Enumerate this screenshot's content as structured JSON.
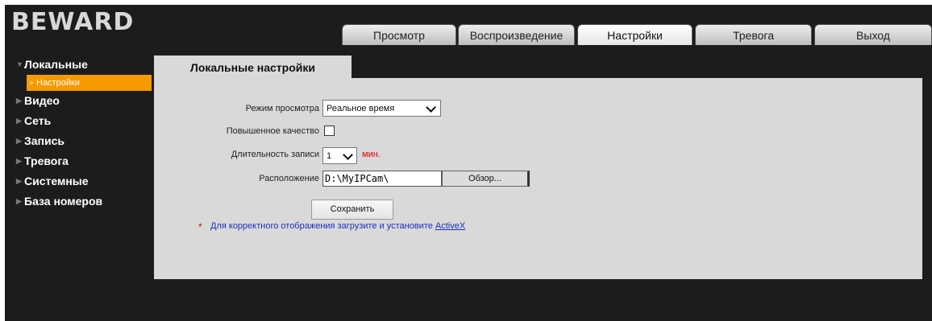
{
  "app": {
    "logo": "BEWARD"
  },
  "tabs": [
    {
      "label": "Просмотр",
      "active": false
    },
    {
      "label": "Воспроизведение",
      "active": false
    },
    {
      "label": "Настройки",
      "active": true
    },
    {
      "label": "Тревога",
      "active": false
    },
    {
      "label": "Выход",
      "active": false
    }
  ],
  "sidebar": {
    "items": [
      {
        "label": "Локальные",
        "expanded": true
      },
      {
        "label": "Видео"
      },
      {
        "label": "Сеть"
      },
      {
        "label": "Запись"
      },
      {
        "label": "Тревога"
      },
      {
        "label": "Системные"
      },
      {
        "label": "База номеров"
      }
    ],
    "sub_item": {
      "label": "Настройки"
    }
  },
  "content": {
    "tab_title": "Локальные настройки",
    "view_mode": {
      "label": "Режим просмотра",
      "value": "Реальное время"
    },
    "quality": {
      "label": "Повышенное качество",
      "checked": false
    },
    "duration": {
      "label": "Длительность записи",
      "value": "1",
      "unit": "мин."
    },
    "location": {
      "label": "Расположение",
      "value": "D:\\MyIPCam\\",
      "browse": "Обзор..."
    },
    "save": "Сохранить",
    "note": {
      "asterisk": "*",
      "text": "Для корректного отображения загрузите и установите ",
      "link": "ActiveX"
    }
  },
  "colors": {
    "accent": "#f59a00",
    "panel": "#d9d9d9",
    "background": "#1c1c1c",
    "unit_red": "#e00000",
    "note_blue": "#1a2fbf"
  }
}
